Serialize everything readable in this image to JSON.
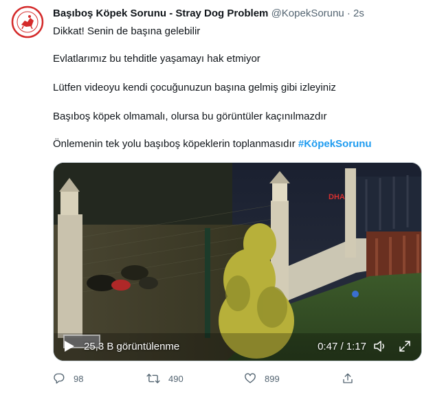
{
  "author": {
    "name": "Başıboş Köpek Sorunu - Stray Dog Problem",
    "handle": "@KopekSorunu",
    "separator": "·",
    "time": "2s"
  },
  "tweet_lines": [
    "Dikkat! Senin de başına gelebilir",
    "Evlatlarımız bu tehditle yaşamayı hak etmiyor",
    "Lütfen videoyu kendi çocuğunuzun başına gelmiş gibi izleyiniz",
    "Başıboş köpek olmamalı, olursa bu görüntüler kaçınılmazdır",
    "Önlemenin tek yolu başıboş köpeklerin toplanmasıdır"
  ],
  "hashtag": "#KöpekSorunu",
  "video": {
    "views": "25,3 B görüntülenme",
    "duration": "0:47 / 1:17",
    "watermark": "DHA"
  },
  "actions": {
    "reply_count": "98",
    "retweet_count": "490",
    "like_count": "899"
  },
  "colors": {
    "link": "#1d9bf0",
    "secondary_text": "#536471",
    "avatar_red": "#d42a2a"
  },
  "icons": {
    "reply": "speech-bubble",
    "retweet": "two-arrows-loop",
    "like": "heart",
    "share": "upload-arrow",
    "play": "triangle",
    "mute": "speaker",
    "fullscreen": "diagonal-arrows"
  }
}
